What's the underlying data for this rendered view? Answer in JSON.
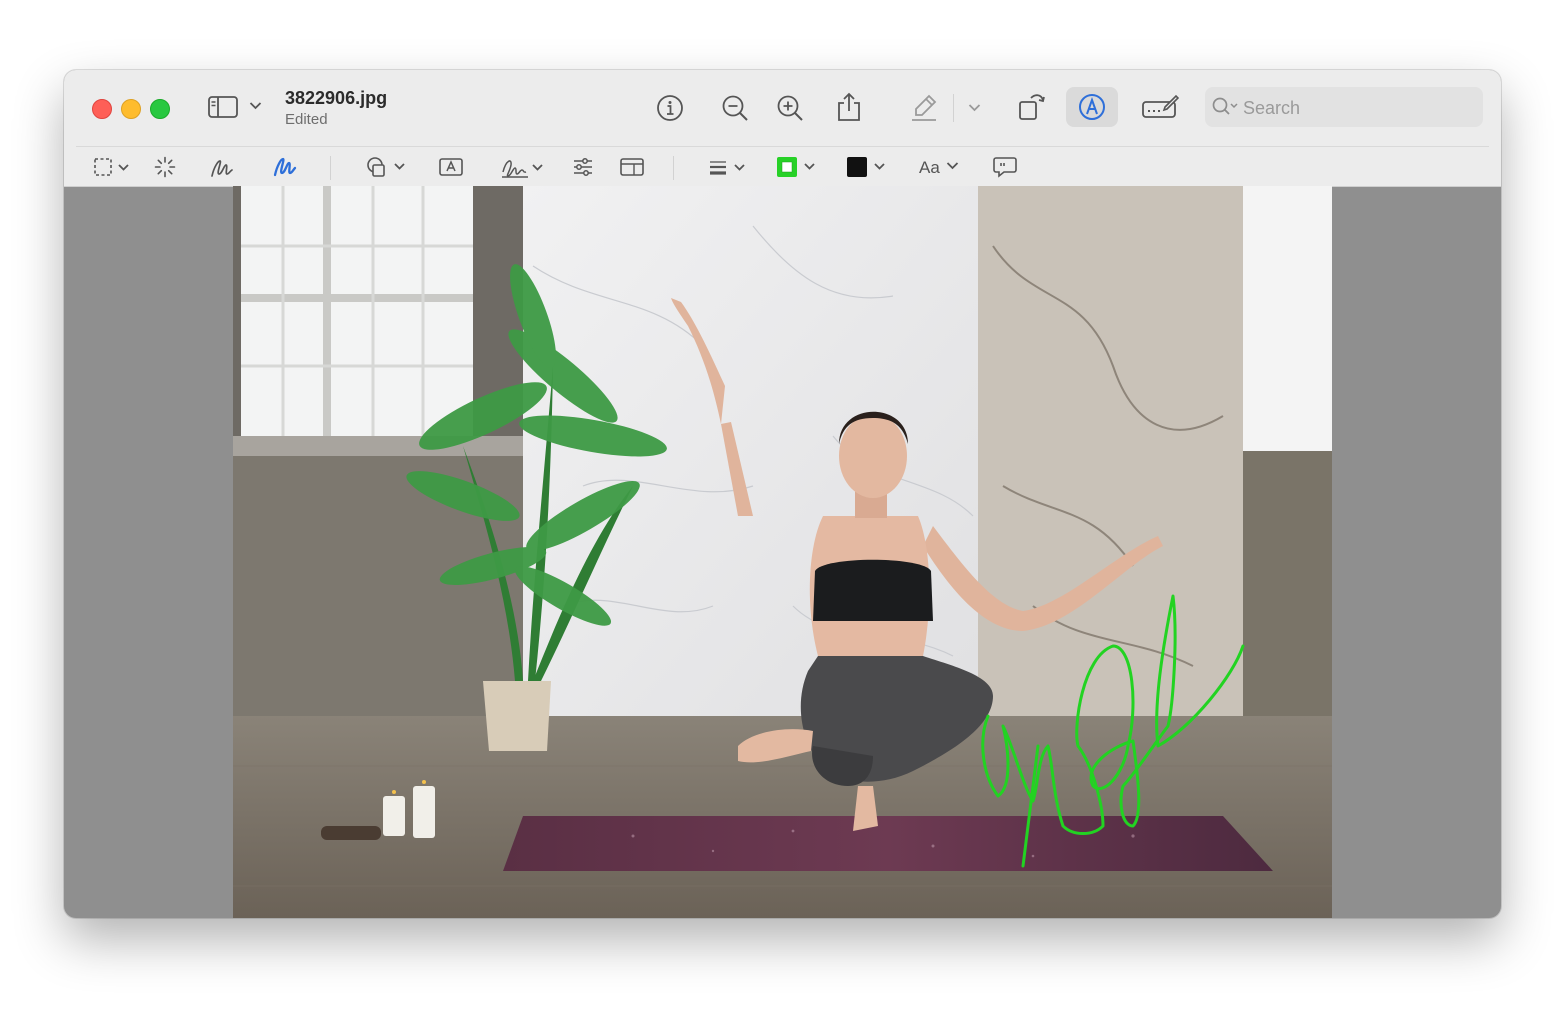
{
  "window": {
    "file_name": "3822906.jpg",
    "status": "Edited"
  },
  "toolbar": {
    "items": [
      {
        "name": "sidebar-toggle",
        "icon": "sidebar-icon"
      },
      {
        "name": "info",
        "icon": "info-icon"
      },
      {
        "name": "zoom-out",
        "icon": "zoom-out-icon"
      },
      {
        "name": "zoom-in",
        "icon": "zoom-in-icon"
      },
      {
        "name": "share",
        "icon": "share-icon"
      },
      {
        "name": "highlight",
        "icon": "highlighter-icon"
      },
      {
        "name": "rotate",
        "icon": "rotate-icon"
      },
      {
        "name": "markup",
        "icon": "markup-pen-icon",
        "active": true
      },
      {
        "name": "form-fill",
        "icon": "form-fill-icon"
      }
    ]
  },
  "search": {
    "placeholder": "Search",
    "value": ""
  },
  "markup_toolbar": {
    "text_style_label": "Aa",
    "border_color": "#27d127",
    "fill_color": "#000000",
    "active_tool": "draw",
    "tools": [
      {
        "name": "rectangular-selection",
        "icon": "selection-icon"
      },
      {
        "name": "instant-alpha",
        "icon": "instant-alpha-icon"
      },
      {
        "name": "sketch",
        "icon": "sketch-icon"
      },
      {
        "name": "draw",
        "icon": "draw-icon"
      },
      {
        "name": "shapes",
        "icon": "shapes-icon"
      },
      {
        "name": "text",
        "icon": "text-box-icon"
      },
      {
        "name": "sign",
        "icon": "signature-icon"
      },
      {
        "name": "adjust-color",
        "icon": "sliders-icon"
      },
      {
        "name": "adjust-size",
        "icon": "resize-icon"
      },
      {
        "name": "shape-style",
        "icon": "line-weight-icon"
      },
      {
        "name": "border-color",
        "icon": "border-color-swatch"
      },
      {
        "name": "fill-color",
        "icon": "fill-color-swatch"
      },
      {
        "name": "text-style",
        "icon": "text-style-icon"
      },
      {
        "name": "annotate",
        "icon": "speech-bubble-icon"
      }
    ]
  },
  "colors": {
    "accent": "#2e6fd9",
    "annotation_stroke": "#22d322"
  }
}
